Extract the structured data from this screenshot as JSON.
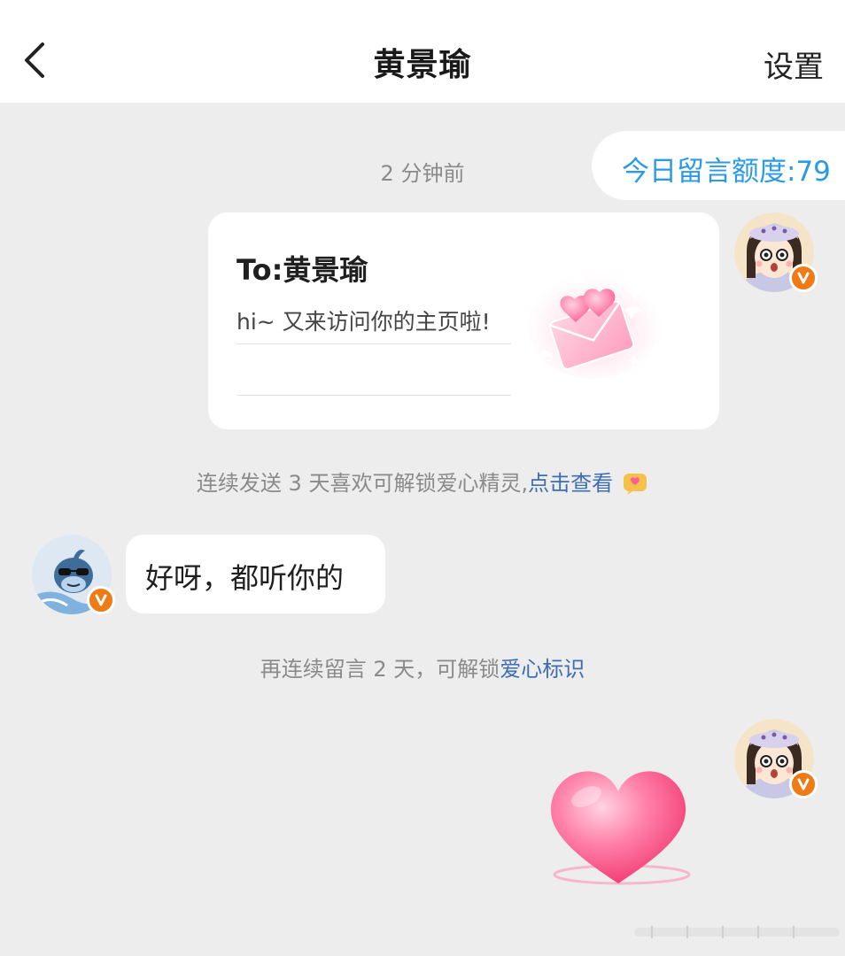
{
  "header": {
    "title": "黄景瑜",
    "settings_label": "设置"
  },
  "quota": {
    "text": "今日留言额度:79"
  },
  "timestamp": "2 分钟前",
  "card": {
    "to_line": "To:黄景瑜",
    "message": "hi~ 又来访问你的主页啦!"
  },
  "notice1": {
    "text": "连续发送 3 天喜欢可解锁爱心精灵,",
    "link": "点击查看"
  },
  "reply": {
    "text": "好呀，都听你的"
  },
  "notice2": {
    "text": "再连续留言 2 天，可解锁",
    "link": "爱心标识"
  },
  "colors": {
    "accent_blue": "#2a9ae8",
    "link_blue": "#3d6eb0",
    "badge_orange": "#f07a16",
    "background": "#ededed"
  },
  "icons": {
    "back": "chevron-left-icon",
    "verified": "verified-v-badge-icon",
    "envelope": "heart-envelope-sticker",
    "spirit": "love-spirit-icon",
    "heart": "heart-sticker"
  }
}
